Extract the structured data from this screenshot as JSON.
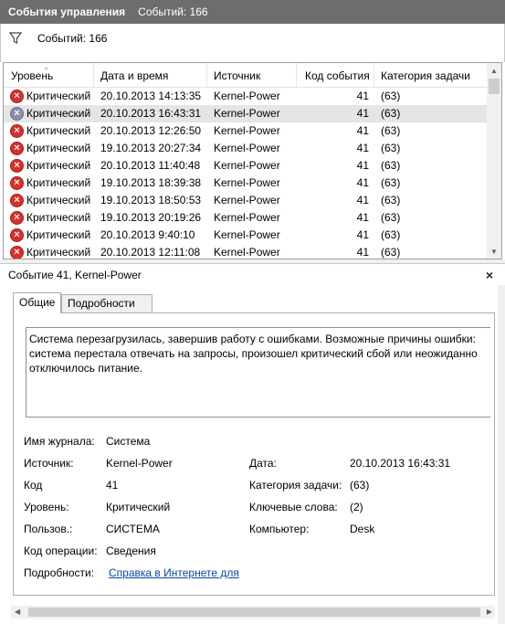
{
  "window": {
    "title": "События управления",
    "count_text": "Событий: 166"
  },
  "filter": {
    "icon": "filter-icon",
    "text": "Событий: 166"
  },
  "grid": {
    "columns": [
      "Уровень",
      "Дата и время",
      "Источник",
      "Код события",
      "Категория задачи"
    ],
    "rows": [
      {
        "level": "Критический",
        "datetime": "20.10.2013 14:13:35",
        "source": "Kernel-Power",
        "code": "41",
        "category": "(63)"
      },
      {
        "level": "Критический",
        "datetime": "20.10.2013 16:43:31",
        "source": "Kernel-Power",
        "code": "41",
        "category": "(63)"
      },
      {
        "level": "Критический",
        "datetime": "20.10.2013 12:26:50",
        "source": "Kernel-Power",
        "code": "41",
        "category": "(63)"
      },
      {
        "level": "Критический",
        "datetime": "19.10.2013 20:27:34",
        "source": "Kernel-Power",
        "code": "41",
        "category": "(63)"
      },
      {
        "level": "Критический",
        "datetime": "20.10.2013 11:40:48",
        "source": "Kernel-Power",
        "code": "41",
        "category": "(63)"
      },
      {
        "level": "Критический",
        "datetime": "19.10.2013 18:39:38",
        "source": "Kernel-Power",
        "code": "41",
        "category": "(63)"
      },
      {
        "level": "Критический",
        "datetime": "19.10.2013 18:50:53",
        "source": "Kernel-Power",
        "code": "41",
        "category": "(63)"
      },
      {
        "level": "Критический",
        "datetime": "19.10.2013 20:19:26",
        "source": "Kernel-Power",
        "code": "41",
        "category": "(63)"
      },
      {
        "level": "Критический",
        "datetime": "20.10.2013 9:40:10",
        "source": "Kernel-Power",
        "code": "41",
        "category": "(63)"
      },
      {
        "level": "Критический",
        "datetime": "20.10.2013 12:11:08",
        "source": "Kernel-Power",
        "code": "41",
        "category": "(63)"
      }
    ],
    "selected_index": 1
  },
  "detail": {
    "title": "Событие 41, Kernel-Power",
    "close": "×",
    "tabs": [
      "Общие",
      "Подробности"
    ],
    "description": "Система перезагрузилась, завершив работу с ошибками. Возможные причины ошибки: система перестала отвечать на запросы, произошел критический сбой или неожиданно отключилось питание.",
    "fields": {
      "log_label": "Имя журнала:",
      "log_value": "Система",
      "source_label": "Источник:",
      "source_value": "Kernel-Power",
      "date_label": "Дата:",
      "date_value": "20.10.2013 16:43:31",
      "code_label": "Код",
      "code_value": "41",
      "category_label": "Категория задачи:",
      "category_value": "(63)",
      "level_label": "Уровень:",
      "level_value": "Критический",
      "keywords_label": "Ключевые слова:",
      "keywords_value": "(2)",
      "user_label": "Пользов.:",
      "user_value": "СИСТЕМА",
      "computer_label": "Компьютер:",
      "computer_value": "Desk",
      "opcode_label": "Код операции:",
      "opcode_value": "Сведения",
      "more_label": "Подробности:",
      "more_link": "Справка в Интернете для"
    }
  },
  "colors": {
    "titlebar": "#6d6d6d",
    "error": "#d9302c",
    "link": "#0645ad"
  }
}
